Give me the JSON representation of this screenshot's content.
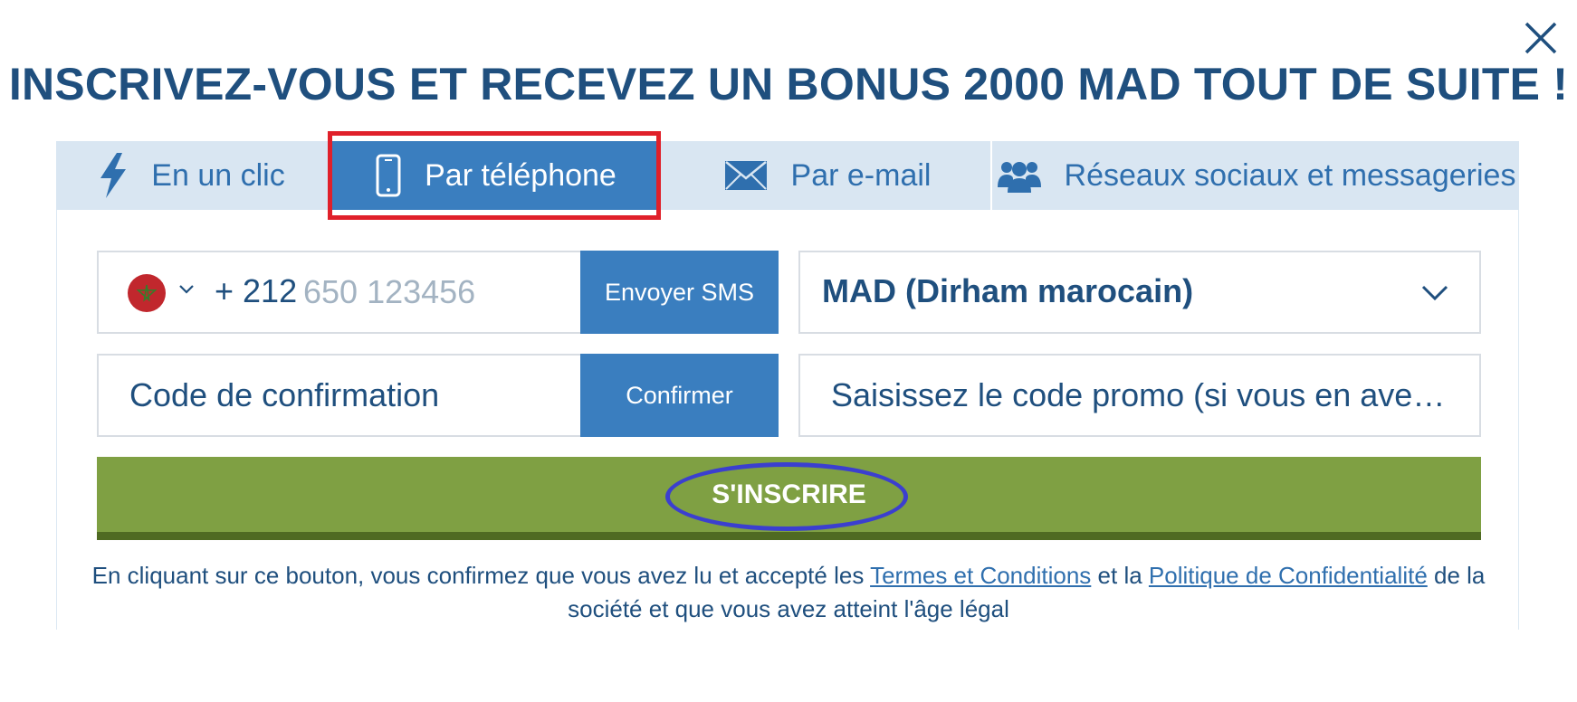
{
  "modal": {
    "title": "INSCRIVEZ-VOUS ET RECEVEZ UN BONUS 2000 MAD TOUT DE SUITE !",
    "close_icon": "close-icon"
  },
  "tabs": [
    {
      "label": "En un clic",
      "icon": "lightning-icon",
      "active": false
    },
    {
      "label": "Par téléphone",
      "icon": "phone-icon",
      "active": true
    },
    {
      "label": "Par e-mail",
      "icon": "envelope-icon",
      "active": false
    },
    {
      "label": "Réseaux sociaux et messageries",
      "icon": "users-icon",
      "active": false
    }
  ],
  "form": {
    "country_icon": "morocco-flag-icon",
    "phone_prefix": "+ 212",
    "phone_placeholder": "650 123456",
    "send_sms_label": "Envoyer SMS",
    "currency_value": "MAD (Dirham marocain)",
    "code_placeholder": "Code de confirmation",
    "confirm_label": "Confirmer",
    "promo_placeholder": "Saisissez le code promo (si vous en avez un)",
    "register_label": "S'INSCRIRE"
  },
  "disclaimer": {
    "before": "En cliquant sur ce bouton, vous confirmez que vous avez lu et accepté les ",
    "terms_link": "Termes et Conditions",
    "middle": " et la ",
    "privacy_link": "Politique de Confidentialité",
    "after": " de la société et que vous avez atteint l'âge légal"
  },
  "colors": {
    "primary_blue": "#3a7ebf",
    "title_blue": "#1f4f7e",
    "tab_bg": "#d9e6f2",
    "register_green": "#7fa043",
    "annotation_red": "#e0202a",
    "annotation_blue": "#3b3fcf"
  }
}
